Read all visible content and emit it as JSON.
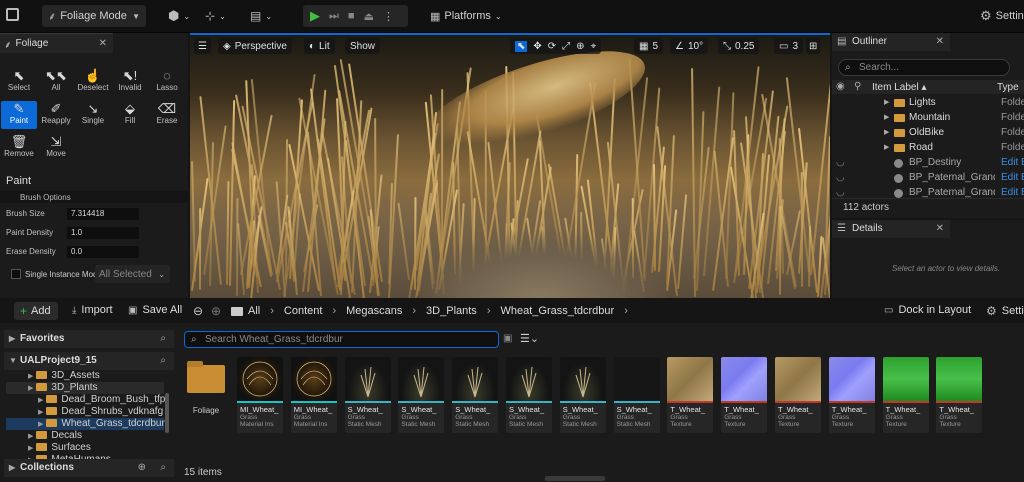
{
  "toolbar": {
    "mode_label": "Foliage Mode",
    "platforms_label": "Platforms",
    "settings_label": "Settings"
  },
  "foliage_panel": {
    "tab_label": "Foliage",
    "tools": [
      {
        "label": "Select",
        "icon": "cursor-icon"
      },
      {
        "label": "All",
        "icon": "select-all-icon"
      },
      {
        "label": "Deselect",
        "icon": "deselect-icon"
      },
      {
        "label": "Invalid",
        "icon": "invalid-icon"
      },
      {
        "label": "Lasso",
        "icon": "lasso-icon"
      },
      {
        "label": "Paint",
        "icon": "brush-icon"
      },
      {
        "label": "Reapply",
        "icon": "reapply-icon"
      },
      {
        "label": "Single",
        "icon": "single-icon"
      },
      {
        "label": "Fill",
        "icon": "fill-icon"
      },
      {
        "label": "Erase",
        "icon": "erase-icon"
      },
      {
        "label": "Remove",
        "icon": "trash-icon"
      },
      {
        "label": "Move",
        "icon": "move-icon"
      }
    ],
    "section_title": "Paint",
    "brush_options_label": "Brush Options",
    "brush_size_label": "Brush Size",
    "brush_size_value": "7.314418",
    "paint_density_label": "Paint Density",
    "paint_density_value": "1.0",
    "erase_density_label": "Erase Density",
    "erase_density_value": "0.0",
    "single_instance_label": "Single Instance Mode",
    "all_selected_label": "All Selected"
  },
  "viewport": {
    "perspective_label": "Perspective",
    "lit_label": "Lit",
    "show_label": "Show",
    "grid_value": "5",
    "angle_value": "10°",
    "scale_value": "0.25",
    "camera_speed": "3"
  },
  "outliner": {
    "tab_label": "Outliner",
    "search_placeholder": "Search...",
    "col_label": "Item Label ▴",
    "col_type": "Type",
    "rows": [
      {
        "label": "Lights",
        "type": "Folder",
        "kind": "folder"
      },
      {
        "label": "Mountain",
        "type": "Folder",
        "kind": "folder"
      },
      {
        "label": "OldBike",
        "type": "Folder",
        "kind": "folder"
      },
      {
        "label": "Road",
        "type": "Folder",
        "kind": "folder"
      },
      {
        "label": "BP_Destiny",
        "type": "Edit BP",
        "kind": "actor"
      },
      {
        "label": "BP_Paternal_Grand",
        "type": "Edit BP",
        "kind": "actor"
      },
      {
        "label": "BP_Paternal_Grand",
        "type": "Edit BP",
        "kind": "actor"
      }
    ],
    "count_label": "112 actors"
  },
  "details": {
    "tab_label": "Details",
    "empty_text": "Select an actor to view details."
  },
  "content_browser": {
    "add_label": "Add",
    "import_label": "Import",
    "save_all_label": "Save All",
    "breadcrumb": [
      "All",
      "Content",
      "Megascans",
      "3D_Plants",
      "Wheat_Grass_tdcrdbur"
    ],
    "dock_label": "Dock in Layout",
    "settings_label": "Settings",
    "search_placeholder": "Search Wheat_Grass_tdcrdbur",
    "favorites_label": "Favorites",
    "project_label": "UALProject9_15",
    "tree": [
      {
        "label": "3D_Assets",
        "depth": 2
      },
      {
        "label": "3D_Plants",
        "depth": 2
      },
      {
        "label": "Dead_Broom_Bush_tfp",
        "depth": 3
      },
      {
        "label": "Dead_Shrubs_vdknafg",
        "depth": 3
      },
      {
        "label": "Wheat_Grass_tdcrdbur",
        "depth": 3,
        "selected": true
      },
      {
        "label": "Decals",
        "depth": 2
      },
      {
        "label": "Surfaces",
        "depth": 2
      },
      {
        "label": "MetaHumans",
        "depth": 2
      }
    ],
    "collections_label": "Collections",
    "items_count": "15 items",
    "folder_label": "Foliage",
    "assets": [
      {
        "name": "MI_Wheat_",
        "t1": "Grass",
        "t2": "Material Ins",
        "color": "#19c4c7",
        "thumb": "sphere"
      },
      {
        "name": "MI_Wheat_",
        "t1": "Grass",
        "t2": "Material Ins",
        "color": "#19c4c7",
        "thumb": "sphere"
      },
      {
        "name": "S_Wheat_",
        "t1": "Grass",
        "t2": "Static Mesh",
        "color": "#35b4c8",
        "thumb": "plant"
      },
      {
        "name": "S_Wheat_",
        "t1": "Grass",
        "t2": "Static Mesh",
        "color": "#35b4c8",
        "thumb": "plant"
      },
      {
        "name": "S_Wheat_",
        "t1": "Grass",
        "t2": "Static Mesh",
        "color": "#35b4c8",
        "thumb": "plant"
      },
      {
        "name": "S_Wheat_",
        "t1": "Grass",
        "t2": "Static Mesh",
        "color": "#35b4c8",
        "thumb": "plant"
      },
      {
        "name": "S_Wheat_",
        "t1": "Grass",
        "t2": "Static Mesh",
        "color": "#35b4c8",
        "thumb": "plant"
      },
      {
        "name": "S_Wheat_",
        "t1": "Grass",
        "t2": "Static Mesh",
        "color": "#35b4c8",
        "thumb": "dark"
      },
      {
        "name": "T_Wheat_",
        "t1": "Grass",
        "t2": "Texture",
        "color": "#c0392b",
        "thumb": "tan"
      },
      {
        "name": "T_Wheat_",
        "t1": "Grass",
        "t2": "Texture",
        "color": "#c0392b",
        "thumb": "normal"
      },
      {
        "name": "T_Wheat_",
        "t1": "Grass",
        "t2": "Texture",
        "color": "#c0392b",
        "thumb": "tan"
      },
      {
        "name": "T_Wheat_",
        "t1": "Grass",
        "t2": "Texture",
        "color": "#c0392b",
        "thumb": "normal"
      },
      {
        "name": "T_Wheat_",
        "t1": "Grass",
        "t2": "Texture",
        "color": "#c0392b",
        "thumb": "green"
      },
      {
        "name": "T_Wheat_",
        "t1": "Grass",
        "t2": "Texture",
        "color": "#c0392b",
        "thumb": "green"
      }
    ]
  }
}
